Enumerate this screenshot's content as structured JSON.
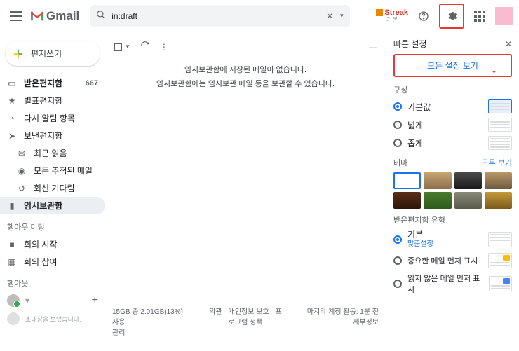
{
  "header": {
    "logo_text": "Gmail",
    "search_value": "in:draft",
    "streak_label": "Streak",
    "streak_sub": "기본"
  },
  "compose_label": "편지쓰기",
  "nav": {
    "inbox": "받은편지함",
    "inbox_count": "667",
    "starred": "별표편지함",
    "snoozed": "다시 알림 항목",
    "sent": "보낸편지함",
    "recent": "최근 읽음",
    "tracked": "모든 추적된 메일",
    "awaiting": "회신 기다림",
    "drafts": "임시보관함"
  },
  "meet": {
    "title": "행아웃 미팅",
    "start": "회의 시작",
    "join": "회의 참여"
  },
  "hangouts": {
    "title": "행아웃",
    "invite_note": "초대장을 보냈습니다."
  },
  "toolbar": {
    "dash": "—"
  },
  "empty": {
    "line1": "임시보관함에 저장된 메일이 없습니다.",
    "line2": "임시보관함에는 임시보관 메일 등을 보관할 수 있습니다."
  },
  "footer": {
    "storage": "15GB 중 2.01GB(13%) 사용",
    "manage": "관리",
    "policy": "약관 · 개인정보 보호 · 프로그램 정책",
    "activity1": "마지막 계정 활동: 1분 전",
    "activity2": "세부정보"
  },
  "panel": {
    "title": "빠른 설정",
    "all_settings": "모든 설정 보기",
    "layout_label": "구성",
    "default": "기본값",
    "comfy": "넓게",
    "compact": "좁게",
    "theme_label": "테마",
    "view_all": "모두 보기",
    "inbox_label": "받은편지함 유형",
    "inbox_default": "기본",
    "inbox_custom": "맞춤설정",
    "important_first": "중요한 메일 먼저 표시",
    "unread_first": "읽지 않은 메일 먼저 표시"
  },
  "themes": [
    {
      "c": "#ffffff",
      "b": "#1a73e8"
    },
    {
      "c": "linear-gradient(#c5a572,#8d6e4a)"
    },
    {
      "c": "linear-gradient(#4a4a4a,#1a1a1a)"
    },
    {
      "c": "linear-gradient(#b8976a,#6e5a3d)"
    },
    {
      "c": "linear-gradient(#5a2e1a,#2e1608)"
    },
    {
      "c": "linear-gradient(#4a7c2e,#2e5a1a)"
    },
    {
      "c": "linear-gradient(#8a8a7a,#5a5a4a)"
    },
    {
      "c": "linear-gradient(#c49a3a,#7a5a1a)"
    }
  ]
}
